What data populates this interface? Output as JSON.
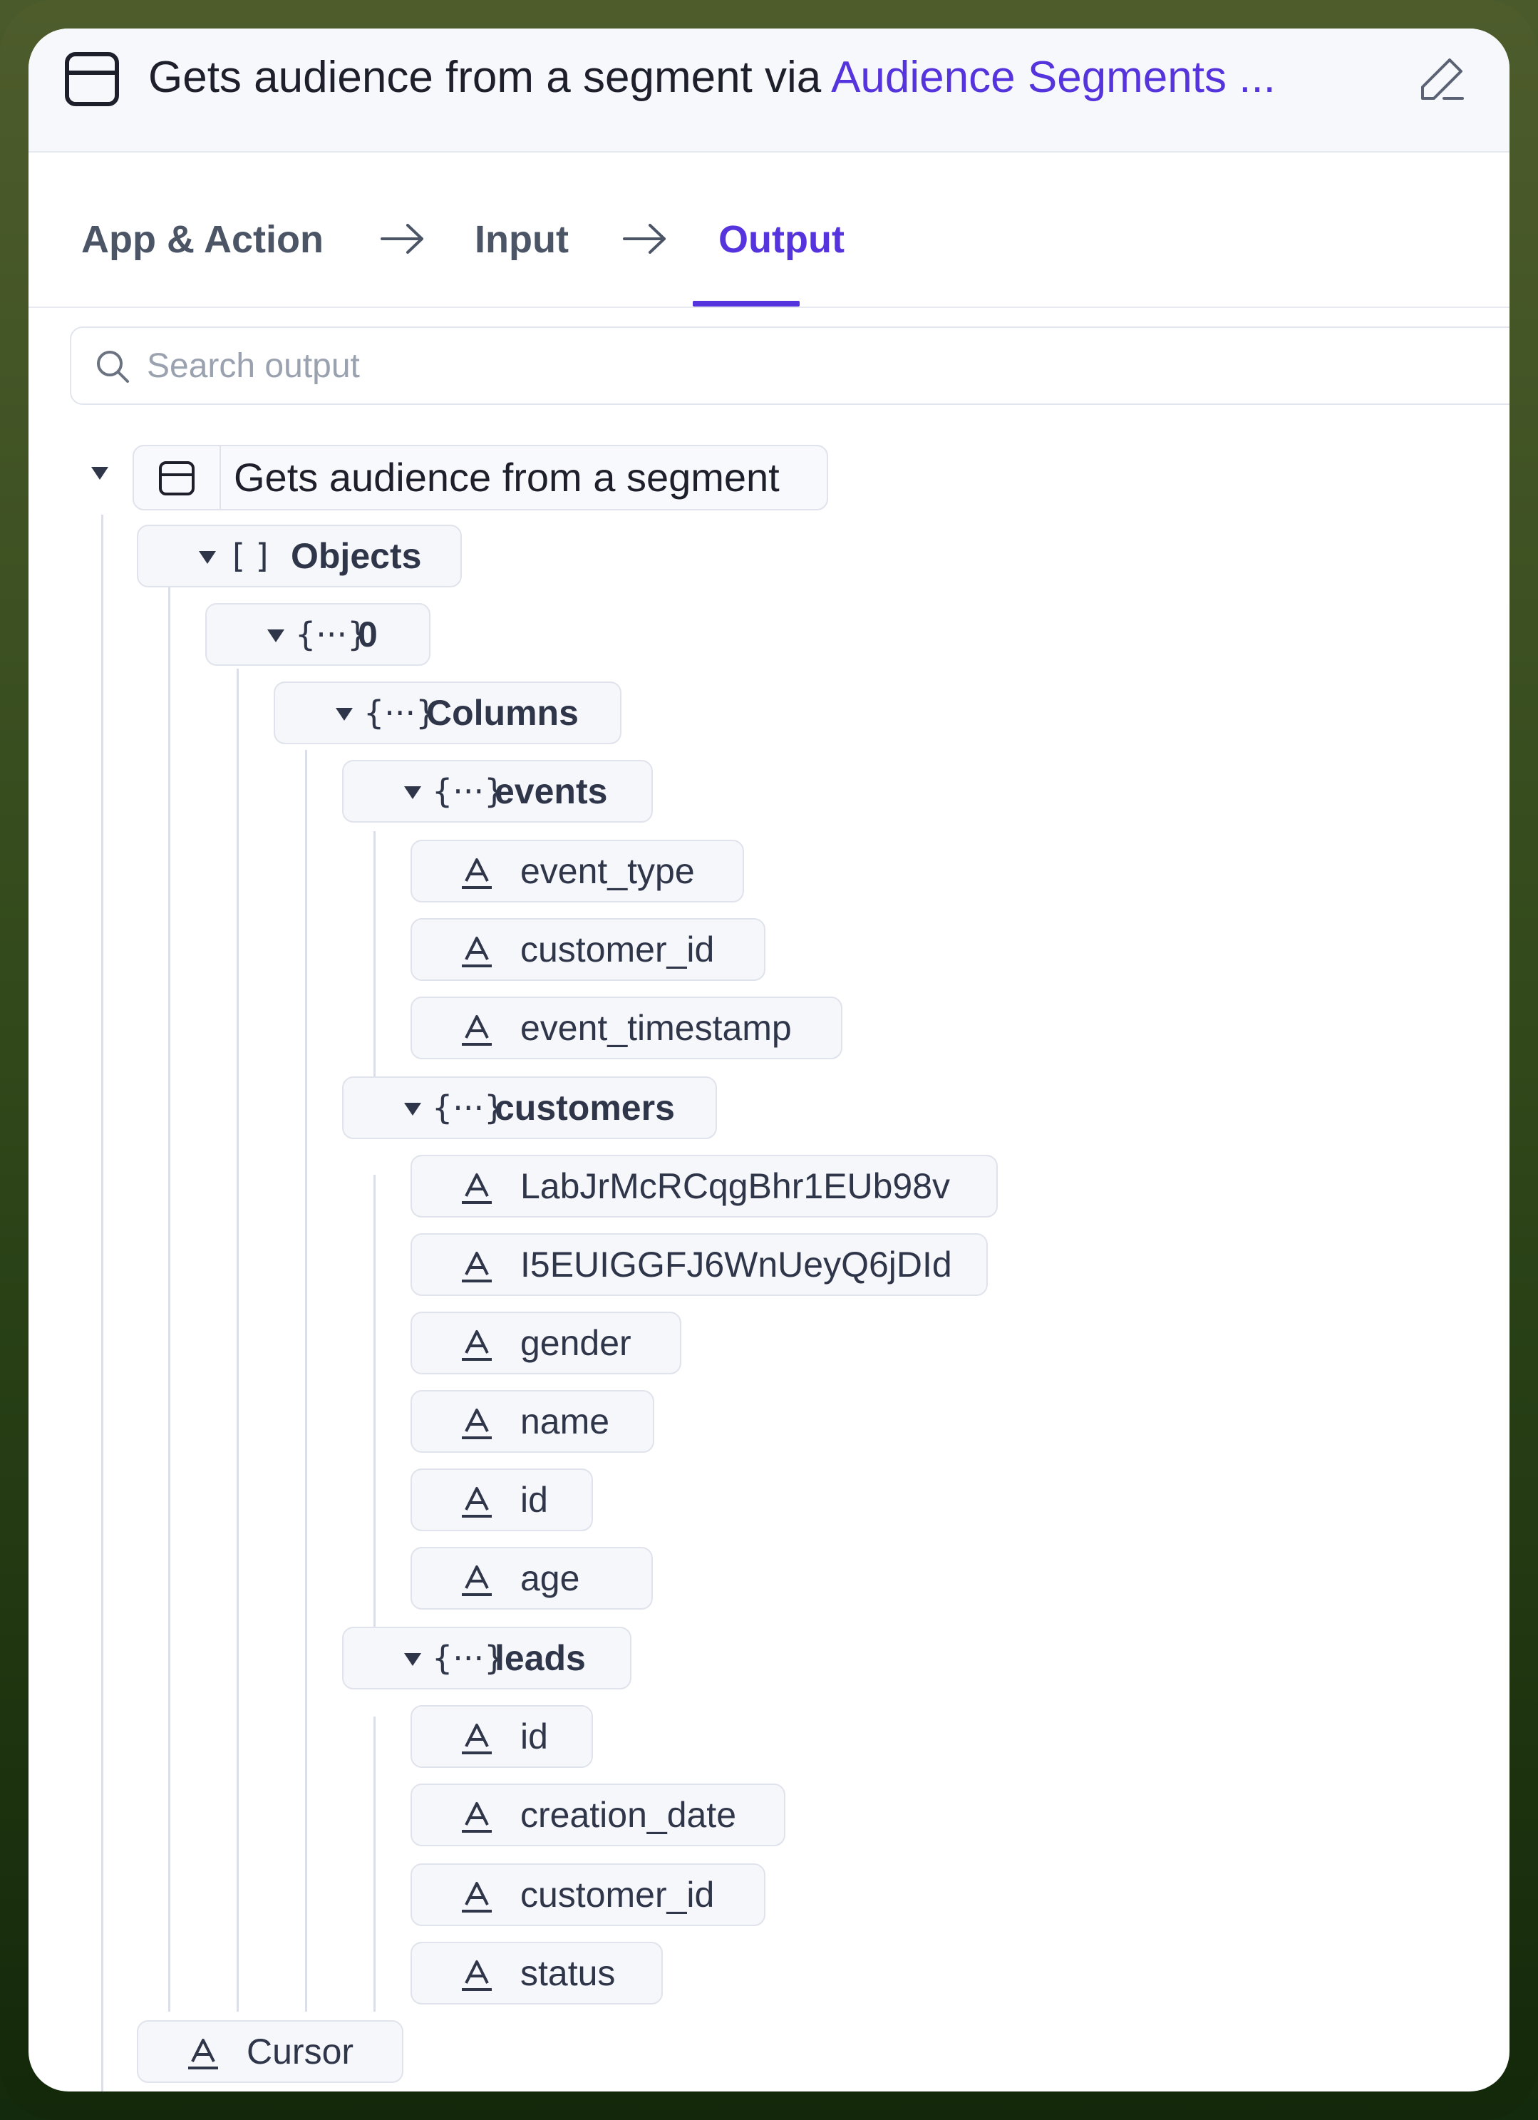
{
  "header": {
    "title_prefix": "Gets audience from a segment via ",
    "title_link": "Audience Segments ..."
  },
  "tabs": [
    {
      "label": "App & Action"
    },
    {
      "label": "Input"
    },
    {
      "label": "Output"
    }
  ],
  "search": {
    "placeholder": "Search output"
  },
  "tree": {
    "root": {
      "label": "Gets audience from a segment"
    },
    "objects": {
      "glyph": "[ ]",
      "label": "Objects"
    },
    "item0": {
      "glyph": "{···}",
      "label": "0"
    },
    "columns": {
      "glyph": "{···}",
      "label": "Columns"
    },
    "events": {
      "glyph": "{···}",
      "label": "events",
      "fields": [
        "event_type",
        "customer_id",
        "event_timestamp"
      ]
    },
    "customers": {
      "glyph": "{···}",
      "label": "customers",
      "fields": [
        "LabJrMcRCqgBhr1EUb98v",
        "I5EUIGGFJ6WnUeyQ6jDId",
        "gender",
        "name",
        "id",
        "age"
      ]
    },
    "leads": {
      "glyph": "{···}",
      "label": "leads",
      "fields": [
        "id",
        "creation_date",
        "customer_id",
        "status"
      ]
    },
    "cursor": {
      "label": "Cursor"
    }
  },
  "colors": {
    "accent": "#5533dd",
    "text": "#1d1f2b",
    "muted": "#4b5566"
  }
}
